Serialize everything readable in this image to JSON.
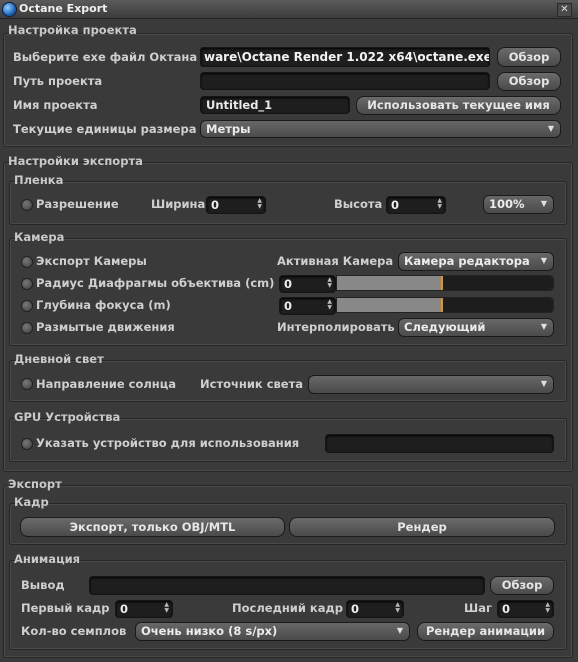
{
  "window": {
    "title": "Octane Export",
    "close_glyph": "✕"
  },
  "project": {
    "group_title": "Настройка проекта",
    "exe_label": "Выберите exe файл Октана",
    "exe_value": "ware\\Octane Render 1.022 x64\\octane.exe",
    "browse_label": "Обзор",
    "path_label": "Путь проекта",
    "path_value": "",
    "name_label": "Имя проекта",
    "name_value": "Untitled_1",
    "use_current_label": "Использовать текущее имя",
    "units_label": "Текущие единицы размера",
    "units_value": "Метры"
  },
  "export_settings": {
    "group_title": "Настройки экспорта",
    "film": {
      "title": "Пленка",
      "resolution_label": "Разрешение",
      "width_label": "Ширина",
      "width_value": "0",
      "height_label": "Высота",
      "height_value": "0",
      "scale_value": "100%"
    },
    "camera": {
      "title": "Камера",
      "export_camera_label": "Экспорт Камеры",
      "active_camera_label": "Активная Камера",
      "active_camera_value": "Камера редактора",
      "aperture_label": "Радиус Диафрагмы объектива (cm)",
      "aperture_value": "0",
      "aperture_slider": 0.48,
      "focus_label": "Глубина фокуса (m)",
      "focus_value": "0",
      "focus_slider": 0.48,
      "motion_blur_label": "Размытые движения",
      "interpolate_label": "Интерполировать",
      "interpolate_value": "Следующий"
    },
    "daylight": {
      "title": "Дневной свет",
      "sun_dir_label": "Направление солнца",
      "light_source_label": "Источник света",
      "light_source_value": ""
    },
    "gpu": {
      "title": "GPU Устройства",
      "specify_label": "Указать устройство для использования",
      "device_value": ""
    }
  },
  "export": {
    "group_title": "Экспорт",
    "frame": {
      "title": "Кадр",
      "export_obj_label": "Экспорт, только OBJ/MTL",
      "render_label": "Рендер"
    },
    "animation": {
      "title": "Анимация",
      "output_label": "Вывод",
      "output_value": "",
      "browse_label": "Обзор",
      "first_frame_label": "Первый кадр",
      "first_frame_value": "0",
      "last_frame_label": "Последний кадр",
      "last_frame_value": "0",
      "step_label": "Шаг",
      "step_value": "0",
      "samples_label": "Кол-во семплов",
      "samples_value": "Очень низко (8 s/px)",
      "render_anim_label": "Рендер анимации"
    }
  },
  "icons": {
    "dropdown": "▼",
    "spin_up": "▲",
    "spin_down": "▼"
  }
}
